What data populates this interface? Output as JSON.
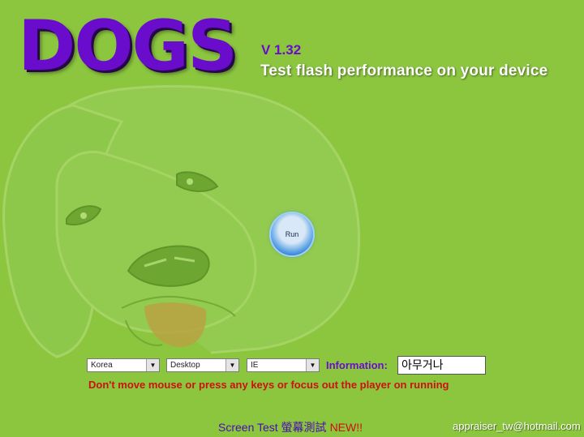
{
  "app": {
    "logo_text": "DOGS",
    "version": "V 1.32",
    "tagline": "Test flash performance on your device"
  },
  "run_button": {
    "label": "Run"
  },
  "controls": {
    "country_select": "Korea",
    "device_select": "Desktop",
    "browser_select": "IE",
    "information_label": "Information:",
    "information_value": "아무거나"
  },
  "warning": "Don't move mouse or press any keys or focus out the player on running",
  "footer": {
    "screen_test_label": "Screen Test 螢幕測試",
    "new_badge": "NEW!!",
    "email": "appraiser_tw@hotmail.com"
  },
  "colors": {
    "background": "#8cc63f",
    "logo_purple": "#6a0ccc",
    "warning_red": "#cc1111"
  },
  "icons": [
    "dog-illustration",
    "dropdown-arrow-icon"
  ]
}
